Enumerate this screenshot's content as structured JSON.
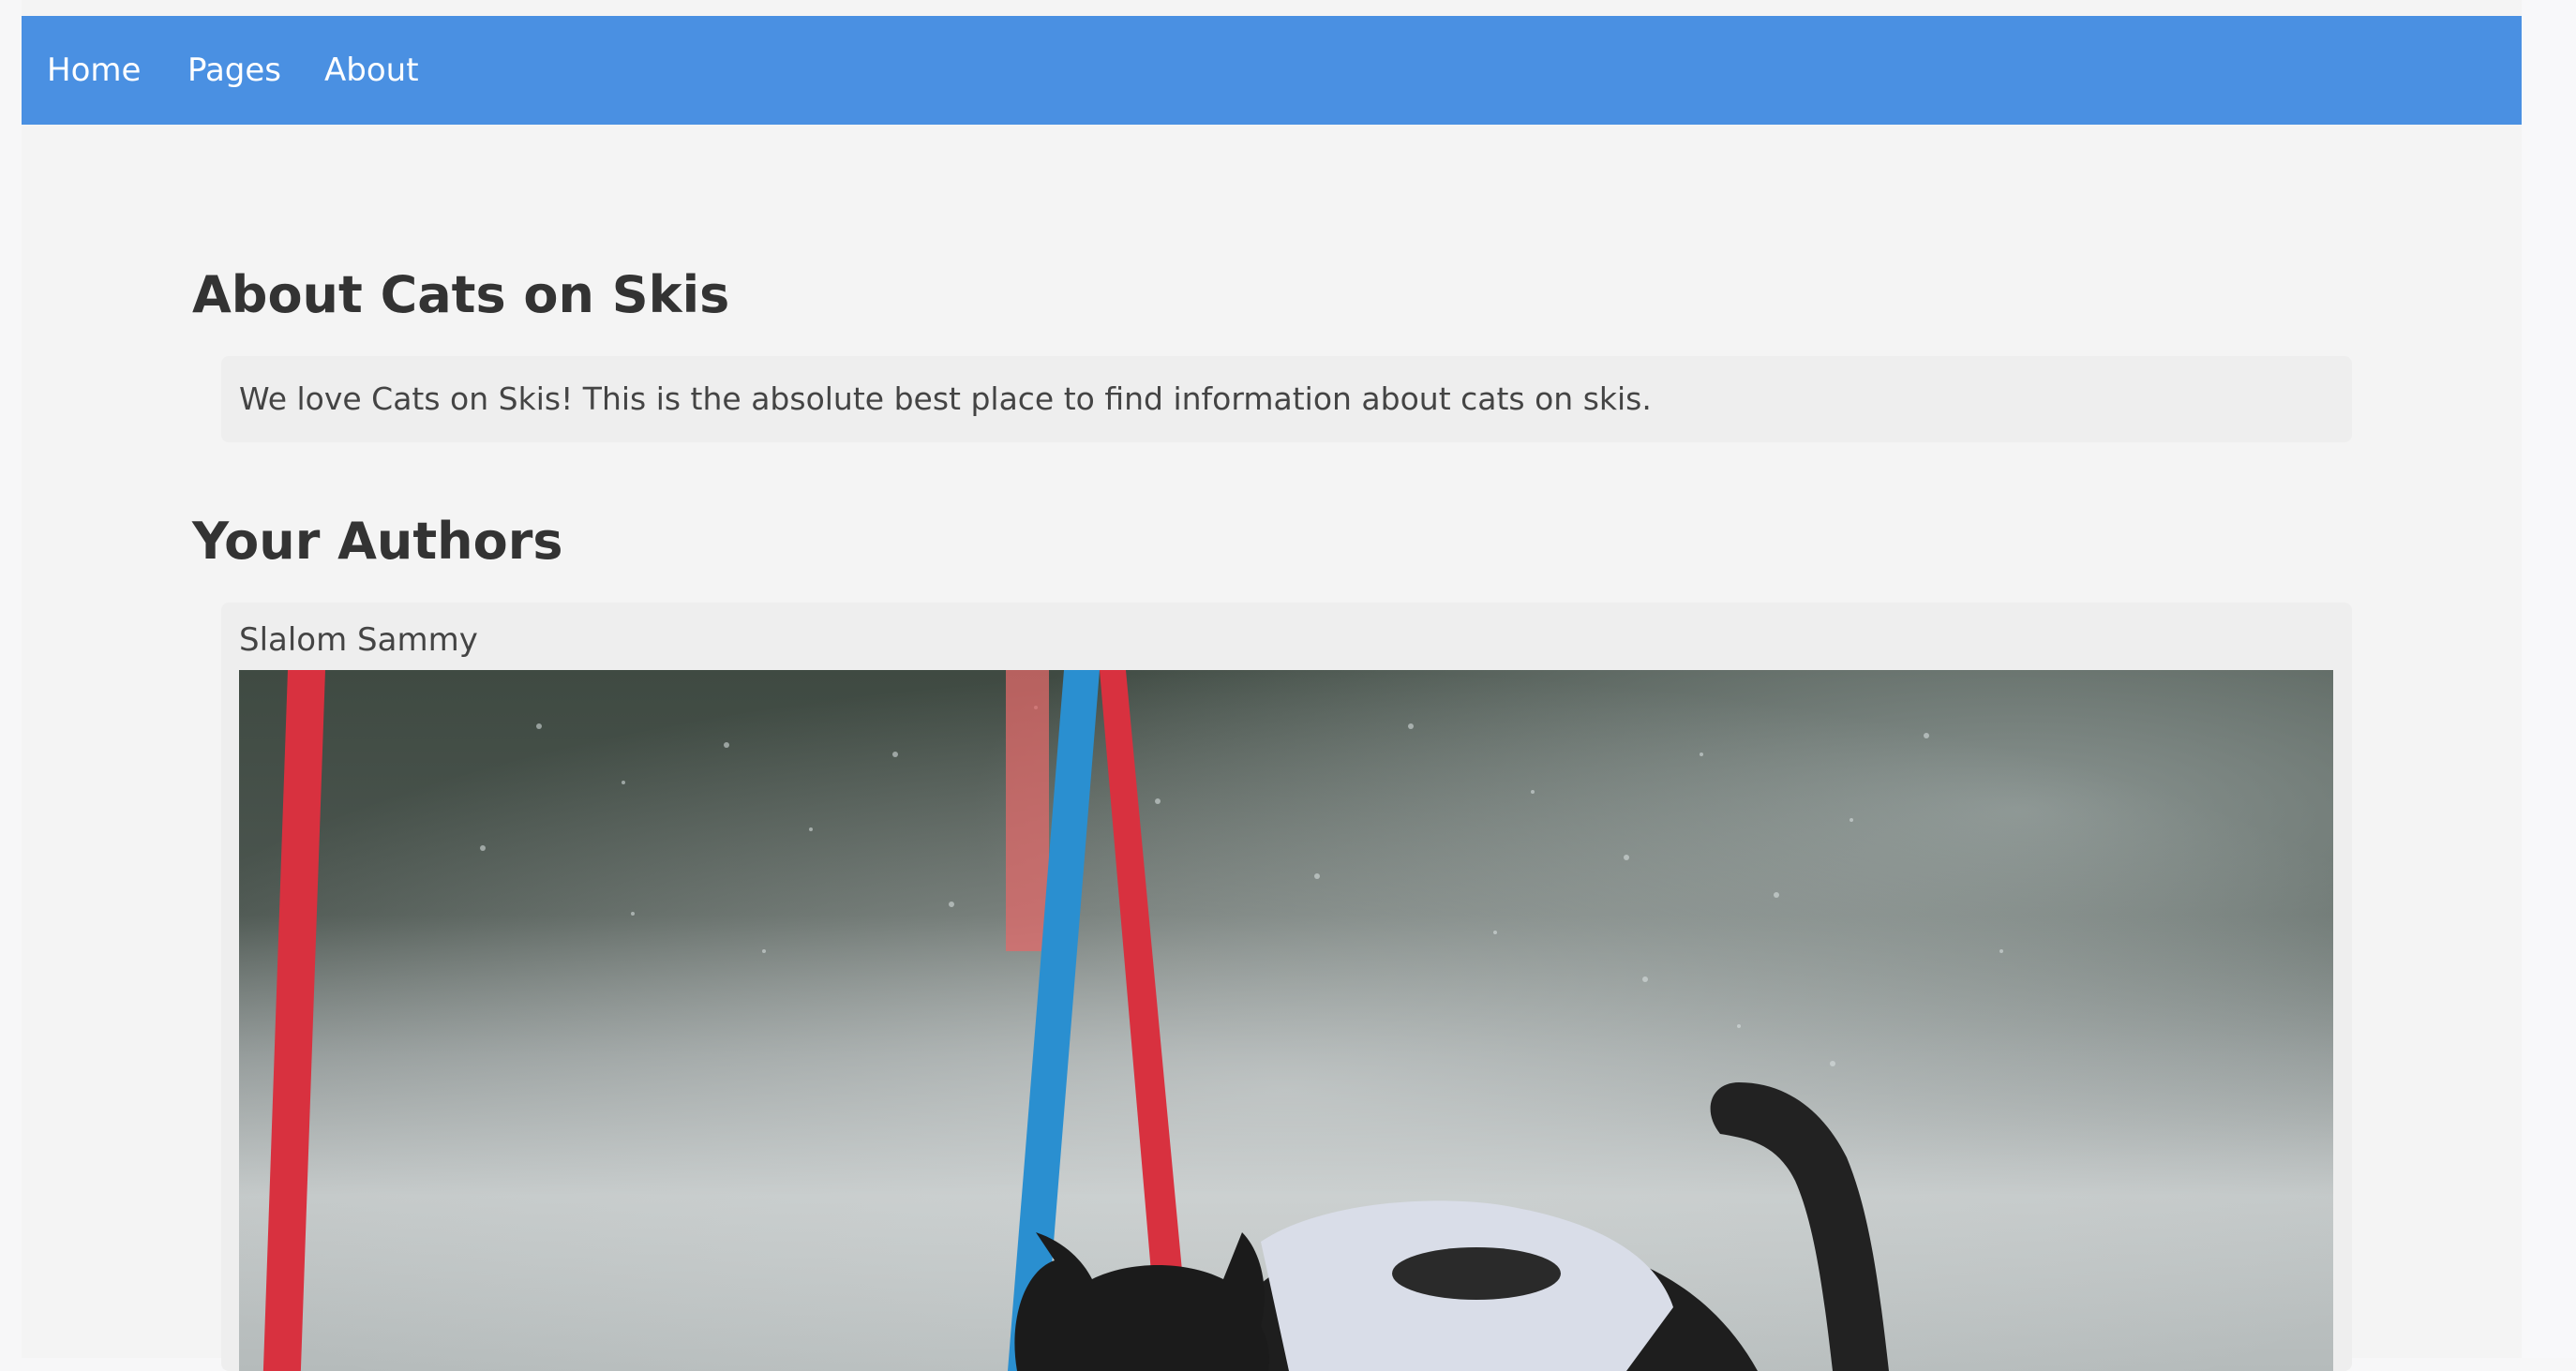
{
  "nav": {
    "items": [
      {
        "label": "Home"
      },
      {
        "label": "Pages"
      },
      {
        "label": "About"
      }
    ],
    "color": "#4a90e2"
  },
  "about": {
    "heading": "About Cats on Skis",
    "text": "We love Cats on Skis! This is the absolute best place to find information about cats on skis."
  },
  "authors": {
    "heading": "Your Authors",
    "items": [
      {
        "name": "Slalom Sammy",
        "photo_icon": "cat-skiing-photo"
      }
    ]
  }
}
